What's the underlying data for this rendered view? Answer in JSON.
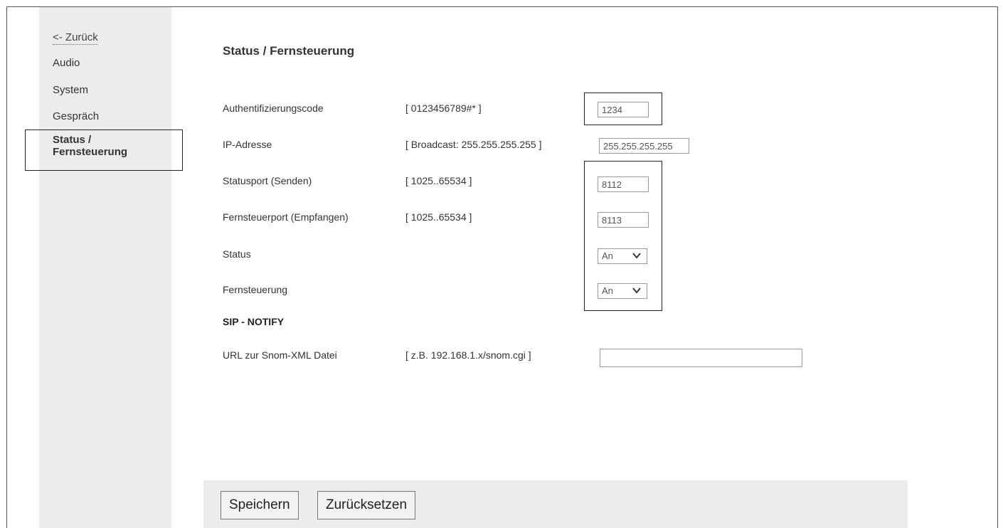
{
  "sidebar": {
    "back_label": "<- Zurück",
    "items": [
      {
        "label": "Audio"
      },
      {
        "label": "System"
      },
      {
        "label": "Gespräch"
      }
    ],
    "active_label": "Status / Fernsteuerung"
  },
  "main": {
    "title": "Status / Fernsteuerung",
    "rows": [
      {
        "label": "Authentifizierungscode",
        "hint": "[ 0123456789#* ]",
        "value": "1234"
      },
      {
        "label": "IP-Adresse",
        "hint": "[ Broadcast: 255.255.255.255 ]",
        "value": "255.255.255.255"
      },
      {
        "label": "Statusport (Senden)",
        "hint": "[ 1025..65534 ]",
        "value": "8112"
      },
      {
        "label": "Fernsteuerport (Empfangen)",
        "hint": "[ 1025..65534 ]",
        "value": "8113"
      },
      {
        "label": "Status",
        "selected": "An"
      },
      {
        "label": "Fernsteuerung",
        "selected": "An"
      }
    ],
    "sip_heading": "SIP - NOTIFY",
    "url_row": {
      "label": "URL zur Snom-XML Datei",
      "hint": "[ z.B. 192.168.1.x/snom.cgi ]",
      "value": ""
    }
  },
  "footer": {
    "save_label": "Speichern",
    "reset_label": "Zurücksetzen"
  }
}
